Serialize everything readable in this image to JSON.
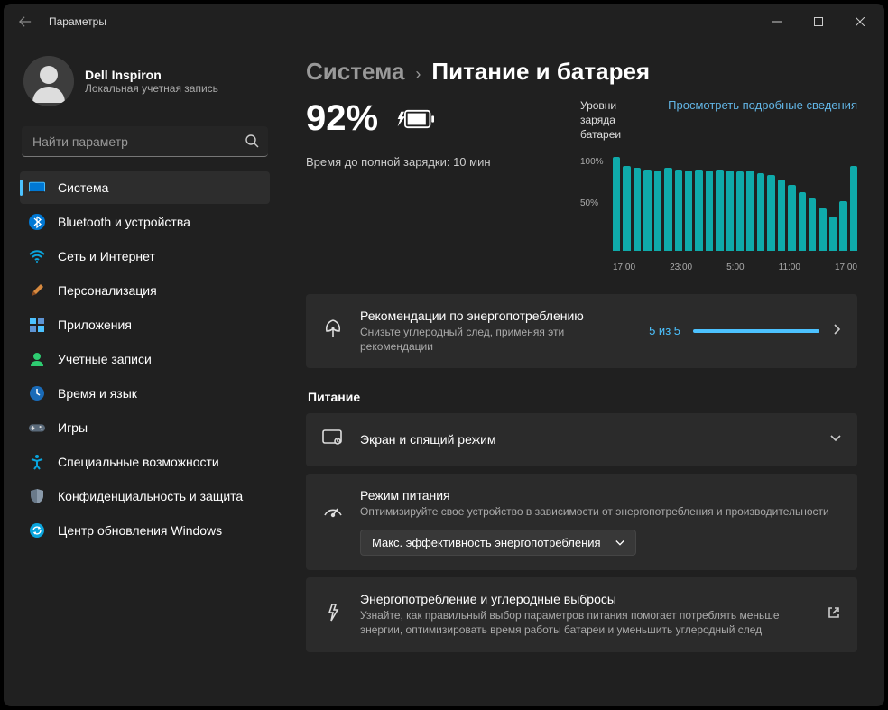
{
  "titlebar": {
    "title": "Параметры"
  },
  "user": {
    "name": "Dell Inspiron",
    "sub": "Локальная учетная запись"
  },
  "search": {
    "placeholder": "Найти параметр"
  },
  "nav": {
    "items": [
      {
        "label": "Система"
      },
      {
        "label": "Bluetooth и устройства"
      },
      {
        "label": "Сеть и Интернет"
      },
      {
        "label": "Персонализация"
      },
      {
        "label": "Приложения"
      },
      {
        "label": "Учетные записи"
      },
      {
        "label": "Время и язык"
      },
      {
        "label": "Игры"
      },
      {
        "label": "Специальные возможности"
      },
      {
        "label": "Конфиденциальность и защита"
      },
      {
        "label": "Центр обновления Windows"
      }
    ]
  },
  "breadcrumb": {
    "parent": "Система",
    "sep": "›",
    "current": "Питание и батарея"
  },
  "battery": {
    "percent": "92%",
    "charge_label": "Время до полной зарядки: ",
    "charge_value": "10 мин"
  },
  "chart": {
    "title": "Уровни заряда батареи",
    "link": "Просмотреть подробные сведения",
    "y100": "100%",
    "y50": "50%",
    "x0": "17:00",
    "x1": "23:00",
    "x2": "5:00",
    "x3": "11:00",
    "x4": "17:00"
  },
  "chart_data": {
    "type": "bar",
    "title": "Уровни заряда батареи",
    "xlabel": "",
    "ylabel": "%",
    "ylim": [
      0,
      100
    ],
    "x_range_labels": [
      "17:00",
      "23:00",
      "5:00",
      "11:00",
      "17:00"
    ],
    "values": [
      100,
      90,
      88,
      86,
      85,
      88,
      86,
      85,
      86,
      85,
      86,
      85,
      84,
      85,
      82,
      80,
      76,
      70,
      62,
      55,
      45,
      36,
      52,
      90
    ]
  },
  "reco": {
    "title": "Рекомендации по энергопотреблению",
    "sub": "Снизьте углеродный след, применяя эти рекомендации",
    "count": "5 из 5"
  },
  "section_power": "Питание",
  "screen": {
    "title": "Экран и спящий режим"
  },
  "mode": {
    "title": "Режим питания",
    "sub": "Оптимизируйте свое устройство в зависимости от энергопотребления и производительности",
    "value": "Макс. эффективность энергопотребления"
  },
  "carbon": {
    "title": "Энергопотребление и углеродные выбросы",
    "sub": "Узнайте, как правильный выбор параметров питания помогает потреблять меньше энергии, оптимизировать время работы батареи и уменьшить углеродный след"
  }
}
